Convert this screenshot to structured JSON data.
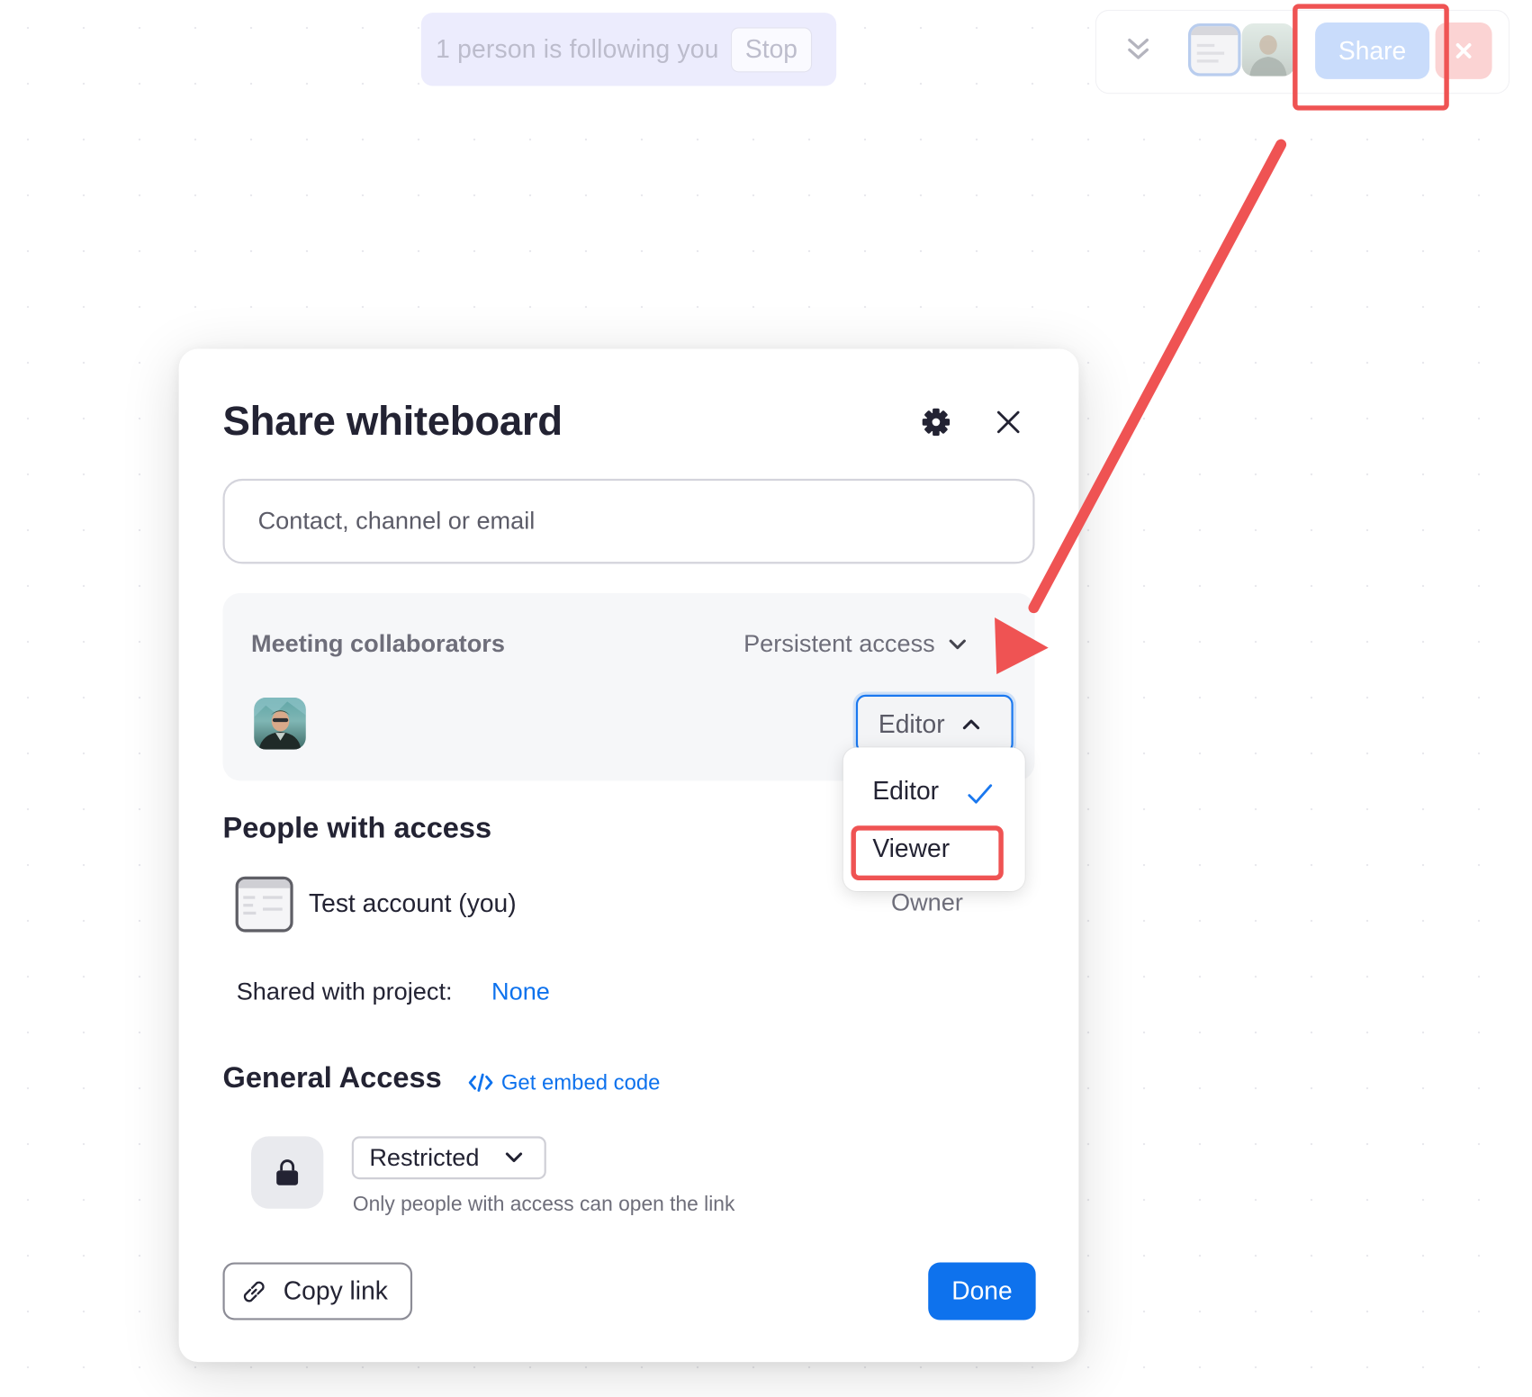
{
  "topbar": {
    "follow_text": "1 person is following you",
    "stop_label": "Stop",
    "share_label": "Share",
    "icons": [
      "chevrons-down-icon",
      "close-icon"
    ],
    "colors": {
      "share_bg": "#c9dcfb",
      "end_bg": "#fbd3d3",
      "banner_bg": "#ececfd"
    }
  },
  "dialog": {
    "title": "Share whiteboard",
    "search_placeholder": "Contact, channel or email",
    "meeting": {
      "title": "Meeting collaborators",
      "access_mode": "Persistent access",
      "role_selected": "Editor",
      "role_options": [
        "Editor",
        "Viewer"
      ]
    },
    "people": {
      "title": "People with access",
      "items": [
        {
          "name": "Test account (you)",
          "role": "Owner"
        }
      ]
    },
    "project": {
      "label": "Shared with project:",
      "value": "None"
    },
    "general_access": {
      "title": "General Access",
      "embed_label": "Get embed code",
      "selected": "Restricted",
      "description": "Only people with access can open the link"
    },
    "copy_link_label": "Copy link",
    "done_label": "Done",
    "colors": {
      "accent": "#0e72ed",
      "annotation": "#ef5353"
    }
  }
}
